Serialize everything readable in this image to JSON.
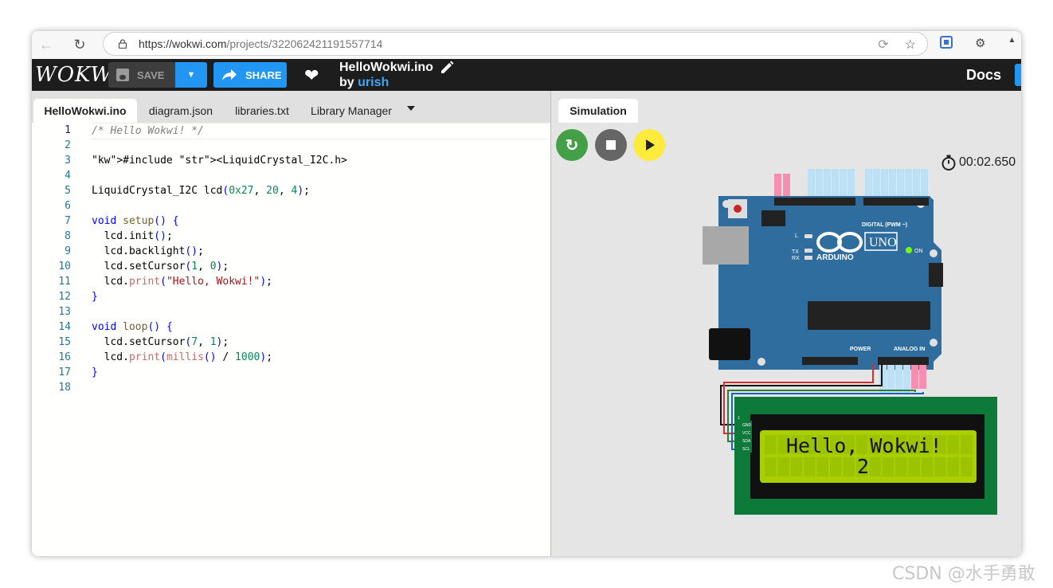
{
  "browser": {
    "url_host": "https://wokwi.com",
    "url_path": "/projects/322062421191557714"
  },
  "app": {
    "logo": "WOKWI",
    "save_label": "SAVE",
    "share_label": "SHARE",
    "project_title": "HelloWokwi.ino",
    "by": "by",
    "author": "urish",
    "docs_label": "Docs"
  },
  "editor": {
    "tabs": [
      "HelloWokwi.ino",
      "diagram.json",
      "libraries.txt",
      "Library Manager"
    ],
    "lines": [
      "/* Hello Wokwi! */",
      "",
      "#include <LiquidCrystal_I2C.h>",
      "",
      "LiquidCrystal_I2C lcd(0x27, 20, 4);",
      "",
      "void setup() {",
      "  lcd.init();",
      "  lcd.backlight();",
      "  lcd.setCursor(1, 0);",
      "  lcd.print(\"Hello, Wokwi!\");",
      "}",
      "",
      "void loop() {",
      "  lcd.setCursor(7, 1);",
      "  lcd.print(millis() / 1000);",
      "}",
      ""
    ]
  },
  "simulation": {
    "tab_label": "Simulation",
    "timer": "00:02.650",
    "board": {
      "brand": "ARDUINO",
      "model": "UNO",
      "on_label": "ON",
      "digital_label": "DIGITAL (PWM ~)",
      "power_label": "POWER",
      "analog_label": "ANALOG IN",
      "l_label": "L",
      "tx_label": "TX",
      "rx_label": "RX"
    },
    "lcd": {
      "line1": "Hello, Wokwi!",
      "line2": "2",
      "pins": [
        "GND",
        "VCC",
        "SDA",
        "SCL"
      ]
    },
    "colors": {
      "lcd_backlight": "#a8d000",
      "board": "#2e6d9e",
      "lcd_pcb": "#0d7a3a"
    }
  },
  "watermark": "CSDN @水手勇敢"
}
